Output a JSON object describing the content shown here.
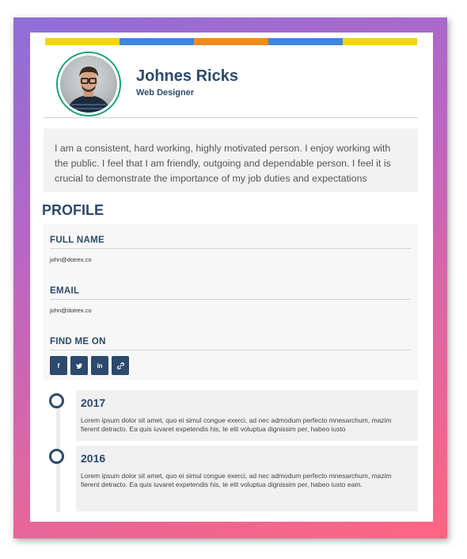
{
  "colors": {
    "primary": "#2c4a6b",
    "accent_ring": "#1aa37a",
    "stripes": [
      "#f5d21b",
      "#3e86e0",
      "#f78a1b",
      "#3e86e0",
      "#f5d21b"
    ]
  },
  "header": {
    "name": "Johnes Ricks",
    "role": "Web Designer"
  },
  "intro": "I am a consistent, hard working, highly motivated person. I enjoy working with the public. I feel that I am friendly, outgoing and dependable person. I feel it is crucial to demonstrate the importance of my job duties and expectations",
  "profile": {
    "title": "PROFILE",
    "full_name_label": "FULL NAME",
    "full_name_value": "john@dotrex.co",
    "email_label": "EMAIL",
    "email_value": "john@dotrex.co",
    "find_label": "FIND ME ON",
    "socials": [
      {
        "icon": "facebook-icon",
        "glyph": "f"
      },
      {
        "icon": "twitter-icon",
        "glyph": "🐦"
      },
      {
        "icon": "linkedin-icon",
        "glyph": "in"
      },
      {
        "icon": "link-icon",
        "glyph": "🔗"
      }
    ]
  },
  "timeline": [
    {
      "year": "2017",
      "text": "Lorem ipsum dolor sit amet, quo ei simul congue exerci, ad nec admodum perfecto mnesarchum, mazim fierent detracto. Ea quis iuvaret expetendis his, te elit voluptua dignissim per, habeo iusto"
    },
    {
      "year": "2016",
      "text": "Lorem ipsum dolor sit amet, quo ei simul congue exerci, ad nec admodum perfecto mnesarchum, mazim fierent detracto. Ea quis iuvaret expetendis his, te elit voluptua dignissim per, habeo iusto eam."
    }
  ]
}
